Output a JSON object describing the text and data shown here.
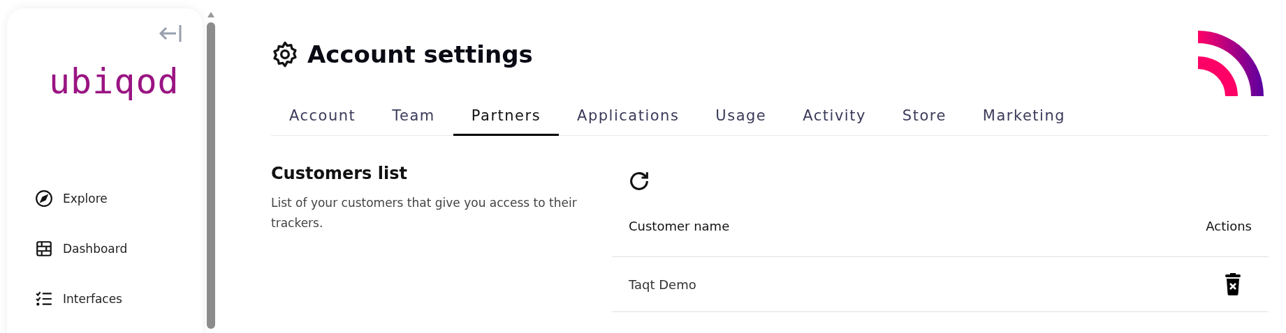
{
  "sidebar": {
    "logo": "ubiqod",
    "items": [
      {
        "label": "Explore",
        "kind": "compass"
      },
      {
        "label": "Dashboard",
        "kind": "bricks"
      },
      {
        "label": "Interfaces",
        "kind": "checklist"
      }
    ]
  },
  "page": {
    "title": "Account settings"
  },
  "tabs": [
    {
      "label": "Account",
      "selected": false
    },
    {
      "label": "Team",
      "selected": false
    },
    {
      "label": "Partners",
      "selected": true
    },
    {
      "label": "Applications",
      "selected": false
    },
    {
      "label": "Usage",
      "selected": false
    },
    {
      "label": "Activity",
      "selected": false
    },
    {
      "label": "Store",
      "selected": false
    },
    {
      "label": "Marketing",
      "selected": false
    }
  ],
  "section": {
    "title": "Customers list",
    "description": "List of your customers that give you access to their trackers."
  },
  "table": {
    "columns": [
      "Customer name",
      "Actions"
    ],
    "rows": [
      {
        "name": "Taqt Demo"
      }
    ]
  }
}
